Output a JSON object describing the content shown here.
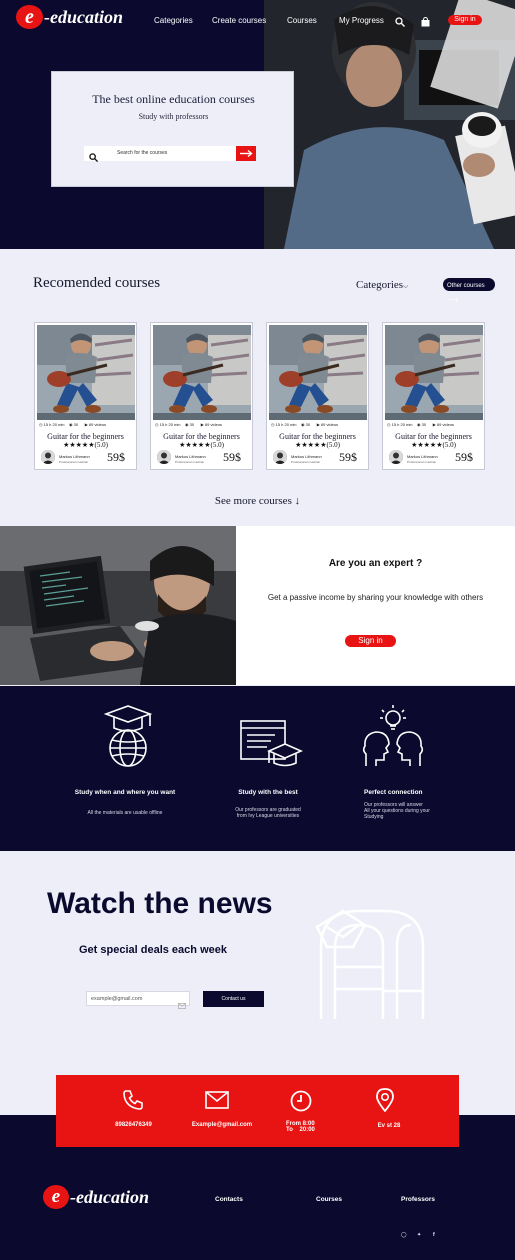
{
  "brand": {
    "logo_letter": "e",
    "logo_text": "-education"
  },
  "nav": {
    "items": [
      "Categories",
      "Create courses",
      "Courses",
      "My Progress"
    ],
    "signin": "Sign in",
    "icons": [
      "search-icon",
      "shopping-bag-icon"
    ]
  },
  "hero": {
    "title": "The best online education courses",
    "subtitle": "Study with professors",
    "search_placeholder": "Search for the courses"
  },
  "recommended": {
    "title": "Recomended courses",
    "categories_label": "Categories",
    "other_label": "Other courses",
    "see_more": "See more courses",
    "courses": [
      {
        "duration": "15 h 20 min",
        "views": "30",
        "videos": "69 videos",
        "title": "Guitar for the beginners",
        "stars": "★★★★★",
        "rating": "(5.0)",
        "author": "Markus Lithmann",
        "author_role": "Professional musician",
        "price": "59$"
      },
      {
        "duration": "15 h 20 min",
        "views": "30",
        "videos": "69 videos",
        "title": "Guitar for the beginners",
        "stars": "★★★★★",
        "rating": "(5.0)",
        "author": "Markus Lithmann",
        "author_role": "Professional musician",
        "price": "59$"
      },
      {
        "duration": "15 h 20 min",
        "views": "30",
        "videos": "69 videos",
        "title": "Guitar for the beginners",
        "stars": "★★★★★",
        "rating": "(5.0)",
        "author": "Markus Lithmann",
        "author_role": "Professional musician",
        "price": "59$"
      },
      {
        "duration": "15 h 20 min",
        "views": "30",
        "videos": "69 videos",
        "title": "Guitar for the beginners",
        "stars": "★★★★★",
        "rating": "(5.0)",
        "author": "Markus Lithmann",
        "author_role": "Professional musician",
        "price": "59$"
      }
    ]
  },
  "expert": {
    "title": "Are you an expert ?",
    "text": "Get a passive income by sharing your knowledge with others",
    "button": "Sign in"
  },
  "features": [
    {
      "icon": "globe-graduation-cap-icon",
      "title": "Study when and where you want",
      "text": [
        "All the materials are usable offline"
      ]
    },
    {
      "icon": "browser-graduation-cap-icon",
      "title": "Study with the best",
      "text": [
        "Our professors are graduated",
        "from Ivy League universities"
      ]
    },
    {
      "icon": "connected-heads-icon",
      "title": "Perfect connection",
      "text": [
        "Our professors will answer",
        "All your questions during your",
        "Studying"
      ]
    }
  ],
  "news": {
    "title": "Watch the news",
    "subtitle": "Get special deals each week",
    "email_placeholder": "example@gmail.com",
    "button": "Contact us",
    "icon": "mailbox-icon"
  },
  "contact": [
    {
      "icon": "phone-icon",
      "text": [
        "89826476349"
      ]
    },
    {
      "icon": "mail-icon",
      "text": [
        "Example@gmail.com"
      ]
    },
    {
      "icon": "clock-icon",
      "text": [
        "From 8:00",
        "To    20:00"
      ]
    },
    {
      "icon": "location-pin-icon",
      "text": [
        "Ev st 28"
      ]
    }
  ],
  "footer": {
    "links": [
      "Contacts",
      "Courses",
      "Professors"
    ],
    "social": [
      "instagram-icon",
      "twitter-icon",
      "facebook-icon"
    ]
  },
  "colors": {
    "navy": "#0b0a2e",
    "red": "#e81414",
    "light": "#edeef8"
  }
}
